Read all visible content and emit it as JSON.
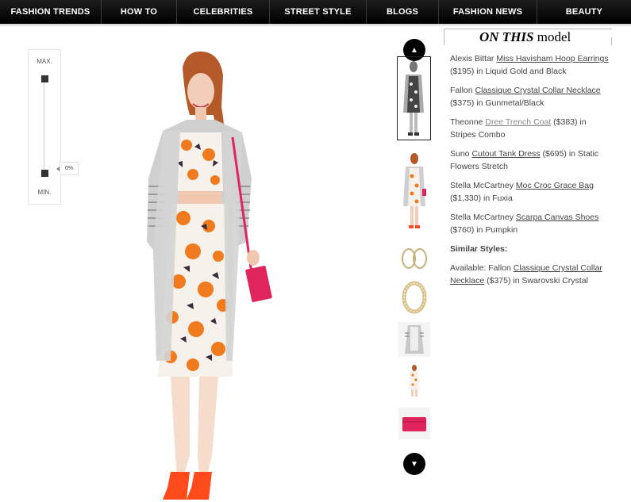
{
  "nav": {
    "items": [
      "FASHION TRENDS",
      "HOW TO",
      "CELEBRITIES",
      "STREET STYLE",
      "BLOGS",
      "FASHION NEWS",
      "BEAUTY"
    ]
  },
  "zoom": {
    "max_label": "MAX.",
    "min_label": "MIN.",
    "level_text": "0%",
    "level": 0
  },
  "panel": {
    "title_em": "ON THIS",
    "title_rest": " model",
    "items": [
      {
        "prefix": "Alexis Bittar ",
        "link": "Miss Havisham Hoop Earrings",
        "suffix": " ($195) in Liquid Gold and Black"
      },
      {
        "prefix": "Fallon ",
        "link": "Classique Crystal Collar Necklace",
        "suffix": " ($375) in Gunmetal/Black"
      },
      {
        "prefix": "Theonne ",
        "link": "Dree Trench Coat",
        "suffix": " ($383) in Stripes Combo"
      },
      {
        "prefix": "Suno ",
        "link": "Cutout Tank Dress",
        "suffix": " ($695) in Static Flowers Stretch"
      },
      {
        "prefix": "Stella McCartney ",
        "link": "Moc Croc Grace Bag",
        "suffix": " ($1,330) in Fuxia"
      },
      {
        "prefix": "Stella McCartney ",
        "link": "Scarpa Canvas Shoes",
        "suffix": " ($760) in Pumpkin"
      }
    ],
    "similar_heading": "Similar Styles:",
    "similar": {
      "prefix": "Available: Fallon ",
      "link": "Classique Crystal Collar Necklace",
      "suffix": " ($375) in Swarovski Crystal"
    }
  },
  "thumbnails": [
    "model-outfit-bw",
    "model-outfit-color",
    "hoop-earrings",
    "collar-necklace",
    "trench-coat",
    "floral-dress",
    "croc-bag"
  ],
  "colors": {
    "nav_bg": "#000000",
    "text": "#444444",
    "accent_orange": "#f07a1e",
    "bag_pink": "#e0245e"
  }
}
